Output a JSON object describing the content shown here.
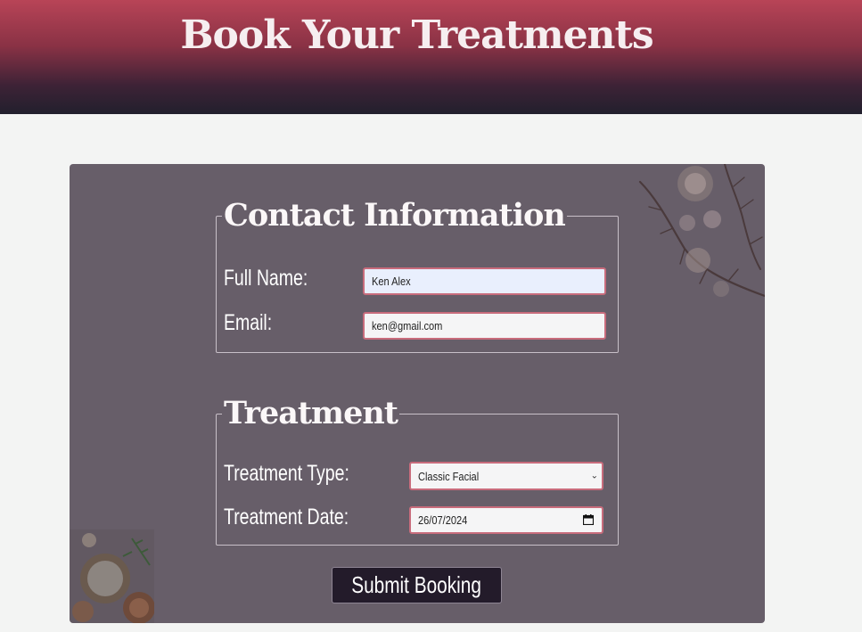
{
  "header": {
    "title": "Book Your Treatments"
  },
  "contact": {
    "legend": "Contact Information",
    "full_name_label": "Full Name:",
    "full_name_value": "Ken Alex",
    "email_label": "Email:",
    "email_value": "ken@gmail.com"
  },
  "treatment": {
    "legend": "Treatment",
    "type_label": "Treatment Type:",
    "type_value": "Classic Facial",
    "date_label": "Treatment Date:",
    "date_value": "26/07/2024"
  },
  "submit": {
    "label": "Submit Booking"
  },
  "icons": {
    "select": "chevron-down-icon",
    "date": "calendar-icon"
  },
  "colors": {
    "header_top": "#b84457",
    "header_bottom": "#22202d",
    "card_bg": "#675e69",
    "field_border": "#c86c7c",
    "button_bg": "#231b2a"
  }
}
